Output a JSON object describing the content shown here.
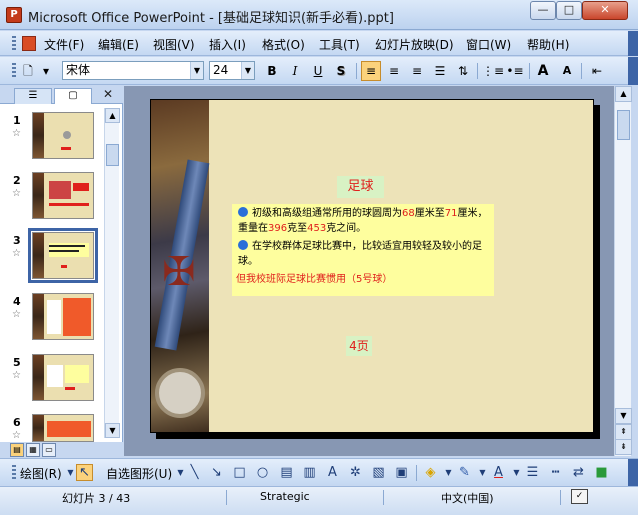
{
  "window": {
    "title": "Microsoft Office PowerPoint - [基础足球知识(新手必看).ppt]",
    "app_icon": "powerpoint-icon",
    "controls": {
      "minimize": "—",
      "maximize": "□",
      "close": "✕"
    }
  },
  "menu": {
    "items": [
      "文件(F)",
      "编辑(E)",
      "视图(V)",
      "插入(I)",
      "格式(O)",
      "工具(T)",
      "幻灯片放映(D)",
      "窗口(W)",
      "帮助(H)"
    ]
  },
  "toolbar": {
    "font_name": "宋体",
    "font_size": "24",
    "bold": "B",
    "italic": "I",
    "underline": "U",
    "shadow": "S",
    "grow_font": "A",
    "shrink_font": "A"
  },
  "left_pane": {
    "tabs": [
      "outline-tab",
      "slides-tab"
    ],
    "close": "✕",
    "thumbnails": [
      {
        "number": "1"
      },
      {
        "number": "2"
      },
      {
        "number": "3",
        "selected": true
      },
      {
        "number": "4"
      },
      {
        "number": "5"
      },
      {
        "number": "6"
      }
    ],
    "star": "☆"
  },
  "slide": {
    "title": "足球",
    "paragraph1_a": "初级和高级组通常所用的球圆周为",
    "paragraph1_b": "68",
    "paragraph1_c": "厘米至",
    "paragraph1_d": "71",
    "paragraph1_e": "厘米，重量在",
    "paragraph1_f": "396",
    "paragraph1_g": "克至",
    "paragraph1_h": "453",
    "paragraph1_i": "克之间。",
    "paragraph2": "在学校群体足球比赛中，比较适宜用较轻及较小的足球。",
    "note": "但我校班际足球比赛惯用（5号球）",
    "page_label": "4页"
  },
  "drawing_toolbar": {
    "draw_menu": "绘图(R)",
    "autoshapes_menu": "自选图形(U)"
  },
  "status": {
    "slide_indicator": "幻灯片 3 / 43",
    "design": "Strategic",
    "language": "中文(中国)"
  },
  "colors": {
    "accent_red": "#e0201c",
    "bullet_blue": "#2a6fd8",
    "slide_bg": "#ede3b8",
    "text_box": "#fefe9e"
  }
}
